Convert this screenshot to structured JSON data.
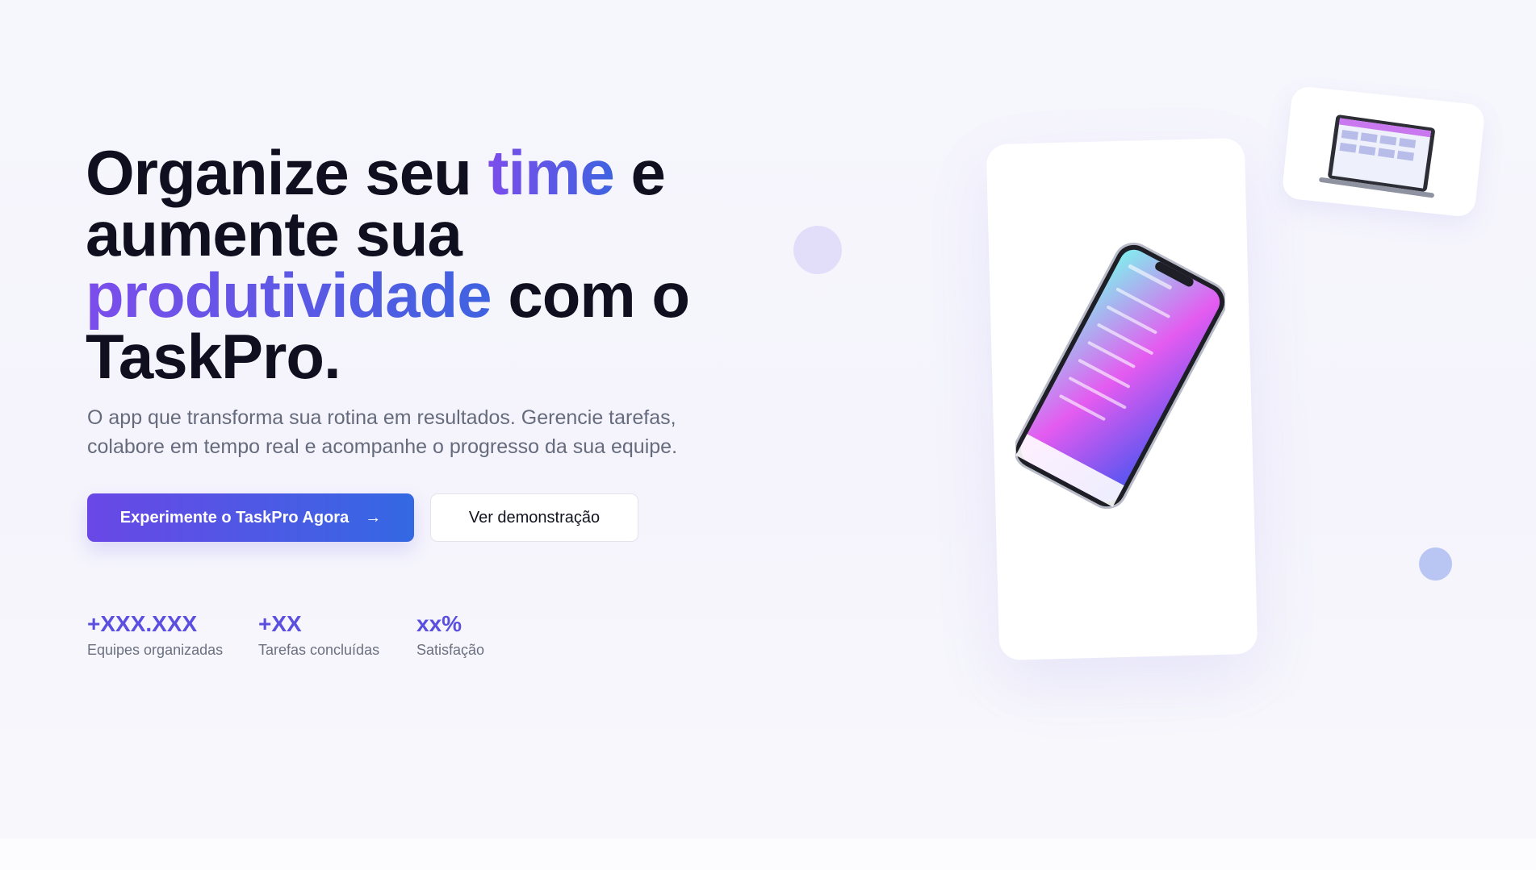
{
  "hero": {
    "headline": {
      "part1": "Organize seu ",
      "highlight1": "time",
      "part2": " e aumente sua ",
      "highlight2": "produtividade",
      "part3": " com o TaskPro."
    },
    "subtitle": "O app que transforma sua rotina em resultados. Gerencie tarefas, colabore em tempo real e acompanhe o progresso da sua equipe.",
    "cta_primary": "Experimente o TaskPro Agora",
    "cta_primary_icon": "arrow-right-icon",
    "cta_secondary": "Ver demonstração"
  },
  "stats": [
    {
      "value": "+XXX.XXX",
      "label": "Equipes organizadas"
    },
    {
      "value": "+XX",
      "label": "Tarefas concluídas"
    },
    {
      "value": "xx%",
      "label": "Satisfação"
    }
  ],
  "colors": {
    "accent_start": "#6a47e6",
    "accent_end": "#3468e3",
    "heading": "#0f0f1f",
    "muted": "#656b7c",
    "stat_value": "#5b4fe0"
  },
  "images": {
    "phone": "phone-mockup-image",
    "laptop": "laptop-mockup-image"
  }
}
